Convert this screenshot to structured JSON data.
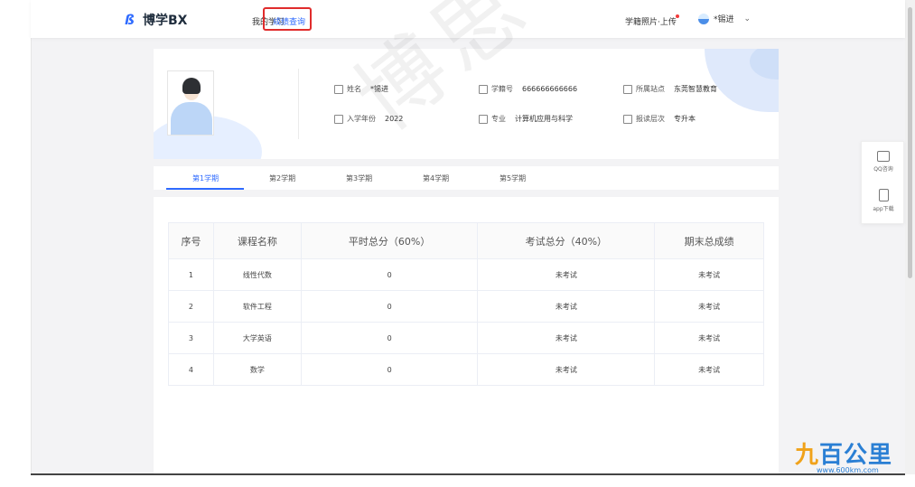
{
  "app": {
    "logo_text": "博学BX"
  },
  "nav": {
    "items": [
      {
        "label": "我的学习"
      },
      {
        "label": "成绩查询"
      }
    ],
    "photo_upload": "学籍照片·上传",
    "user_name": "*锡进",
    "active_index": 1
  },
  "profile": {
    "name_label": "姓名",
    "name_value": "*锡进",
    "student_id_label": "学籍号",
    "student_id_value": "666666666666",
    "site_label": "所属站点",
    "site_value": "东莞智慧教育",
    "enroll_year_label": "入学年份",
    "enroll_year_value": "2022",
    "major_label": "专业",
    "major_value": "计算机应用与科学",
    "level_label": "报读层次",
    "level_value": "专升本"
  },
  "tabs": [
    {
      "label": "第1学期"
    },
    {
      "label": "第2学期"
    },
    {
      "label": "第3学期"
    },
    {
      "label": "第4学期"
    },
    {
      "label": "第5学期"
    }
  ],
  "table": {
    "headers": [
      "序号",
      "课程名称",
      "平时总分（60%）",
      "考试总分（40%）",
      "期末总成绩"
    ],
    "rows": [
      [
        "1",
        "线性代数",
        "0",
        "未考试",
        "未考试"
      ],
      [
        "2",
        "软件工程",
        "0",
        "未考试",
        "未考试"
      ],
      [
        "3",
        "大学英语",
        "0",
        "未考试",
        "未考试"
      ],
      [
        "4",
        "数学",
        "0",
        "未考试",
        "未考试"
      ]
    ]
  },
  "side_panel": {
    "qq_label": "QQ咨询",
    "app_label": "app下载"
  },
  "watermark": "博思",
  "brand": {
    "logo_prefix": "九",
    "logo_rest": "百公里",
    "url": "www.600km.com"
  },
  "colors": {
    "accent": "#2f6bff",
    "highlight_box": "#e02c2c",
    "brand": "#2a7fd4"
  }
}
